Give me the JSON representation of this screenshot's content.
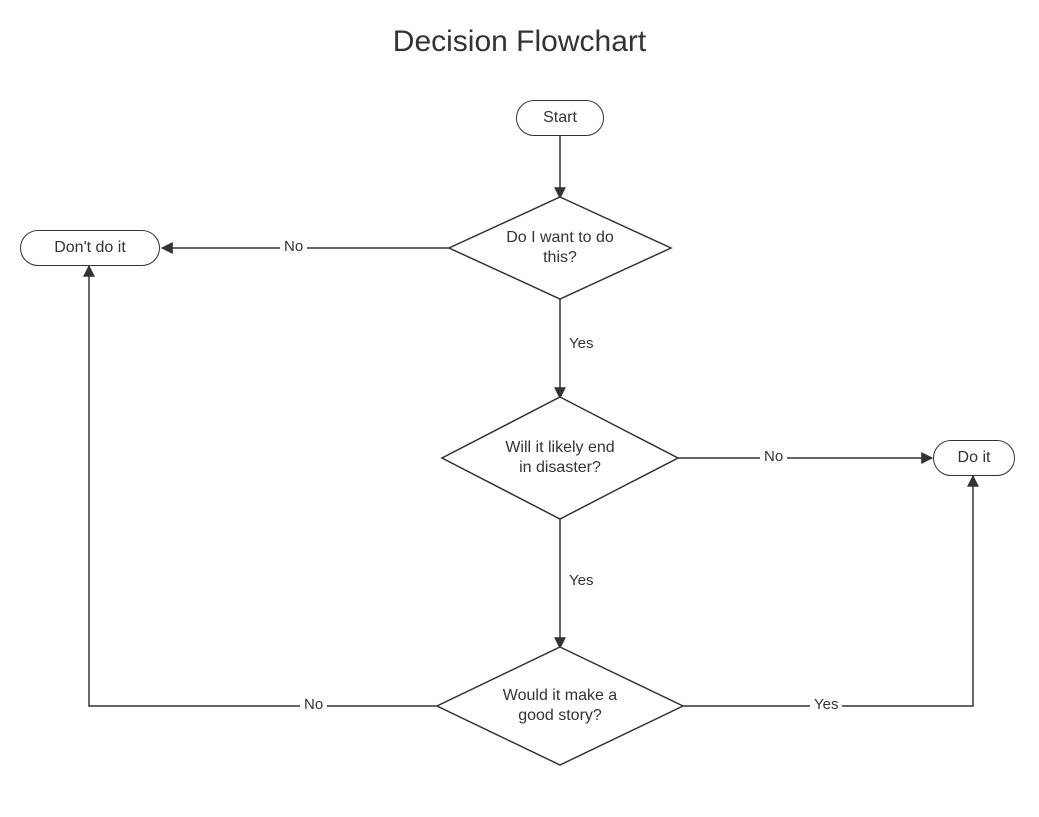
{
  "title": "Decision Flowchart",
  "nodes": {
    "start": {
      "label": "Start"
    },
    "want": {
      "label": "Do I want to do this?"
    },
    "disaster": {
      "label": "Will it likely end in disaster?"
    },
    "story": {
      "label": "Would it make a good story?"
    },
    "dont": {
      "label": "Don't do it"
    },
    "doit": {
      "label": "Do it"
    }
  },
  "edges": {
    "want_no": "No",
    "want_yes": "Yes",
    "disaster_no": "No",
    "disaster_yes": "Yes",
    "story_no": "No",
    "story_yes": "Yes"
  }
}
